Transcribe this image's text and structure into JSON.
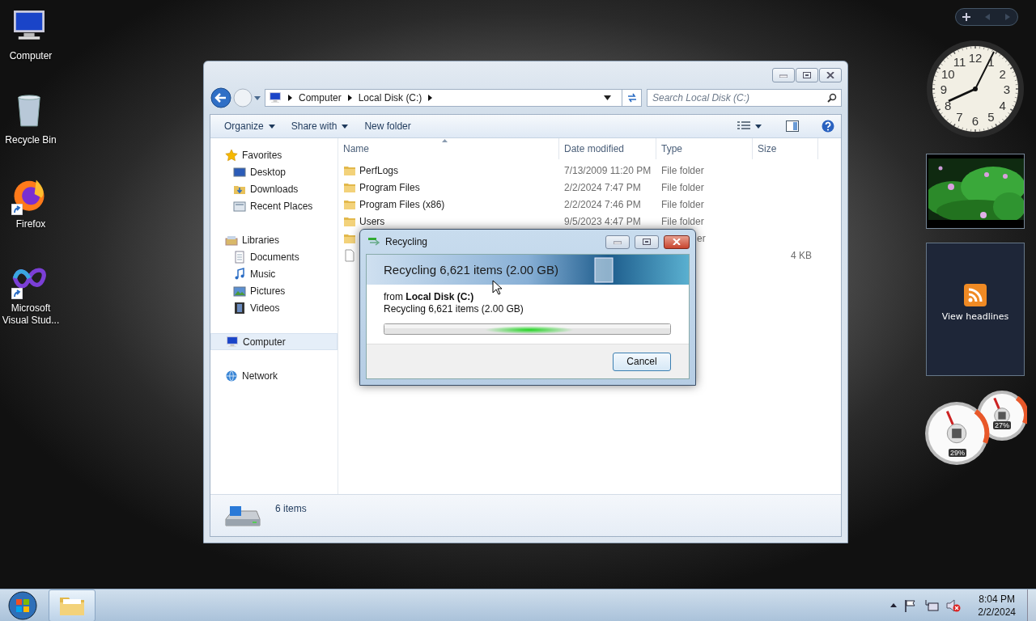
{
  "desktop_icons": [
    {
      "label": "Computer",
      "kind": "computer",
      "shortcut": false
    },
    {
      "label": "Recycle Bin",
      "kind": "recycle",
      "shortcut": false
    },
    {
      "label": "Firefox",
      "kind": "firefox",
      "shortcut": true
    },
    {
      "label": "Microsoft Visual Stud...",
      "kind": "vs",
      "shortcut": true
    }
  ],
  "explorer": {
    "breadcrumbs": [
      "Computer",
      "Local Disk (C:)"
    ],
    "search": {
      "placeholder": "Search Local Disk (C:)"
    },
    "toolbar": [
      {
        "label": "Organize",
        "dropdown": true
      },
      {
        "label": "Share with",
        "dropdown": true
      },
      {
        "label": "New folder",
        "dropdown": false
      }
    ],
    "nav": [
      {
        "label": "Favorites",
        "kind": "star",
        "selected": false,
        "children": [
          {
            "label": "Desktop",
            "kind": "desktop",
            "selected": false
          },
          {
            "label": "Downloads",
            "kind": "downloads",
            "selected": false
          },
          {
            "label": "Recent Places",
            "kind": "recent",
            "selected": false
          }
        ]
      },
      {
        "label": "Libraries",
        "kind": "libraries",
        "selected": false,
        "children": [
          {
            "label": "Documents",
            "kind": "documents",
            "selected": false
          },
          {
            "label": "Music",
            "kind": "music",
            "selected": false
          },
          {
            "label": "Pictures",
            "kind": "pictures",
            "selected": false
          },
          {
            "label": "Videos",
            "kind": "videos",
            "selected": false
          }
        ]
      },
      {
        "label": "Computer",
        "kind": "computer",
        "selected": true
      },
      {
        "label": "Network",
        "kind": "network",
        "selected": false
      }
    ],
    "columns": [
      "Name",
      "Date modified",
      "Type",
      "Size"
    ],
    "rows": [
      {
        "kind": "folder",
        "name": "PerfLogs",
        "date": "7/13/2009 11:20 PM",
        "type": "File folder"
      },
      {
        "kind": "folder",
        "name": "Program Files",
        "date": "2/2/2024 7:47 PM",
        "type": "File folder"
      },
      {
        "kind": "folder",
        "name": "Program Files (x86)",
        "date": "2/2/2024 7:46 PM",
        "type": "File folder"
      },
      {
        "kind": "folder",
        "name": "Users",
        "date": "9/5/2023 4:47 PM",
        "type": "File folder"
      },
      {
        "kind": "folder",
        "type": "er"
      },
      {
        "kind": "file",
        "size": "4 KB"
      }
    ],
    "status": "6 items"
  },
  "dialog": {
    "title": "Recycling",
    "heading": "Recycling 6,621 items (2.00 GB)",
    "source": "from **Local Disk (C:)**",
    "detail": "Recycling 6,621 items (2.00 GB)",
    "indeterminate": true,
    "button": "Cancel"
  },
  "gadgets": {
    "clock_numerals": [
      "12",
      "11",
      "1",
      "10",
      "2",
      "9",
      "3",
      "8",
      "4",
      "7",
      "5",
      "6"
    ],
    "feed": "View headlines",
    "meters": [
      "29%",
      "27%"
    ]
  },
  "taskbar": {
    "time": "8:04 PM",
    "date": "2/2/2024"
  }
}
